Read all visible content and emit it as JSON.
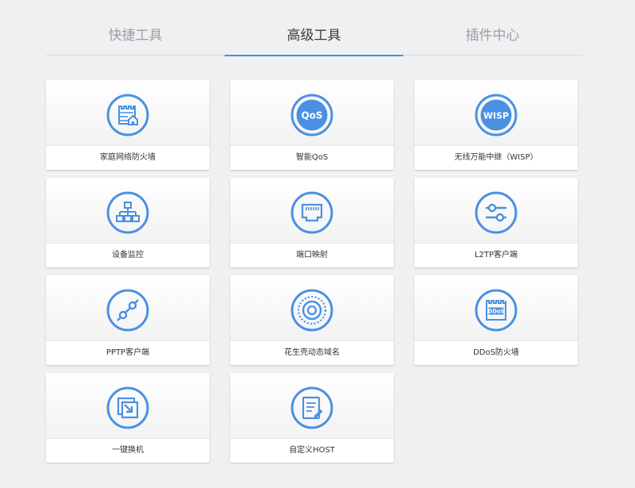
{
  "tabs": [
    {
      "label": "快捷工具"
    },
    {
      "label": "高级工具"
    },
    {
      "label": "插件中心"
    }
  ],
  "active_tab": "高级工具",
  "accent_color": "#4a90e2",
  "tools": [
    {
      "label": "家庭网络防火墙",
      "icon": "firewall-house-icon"
    },
    {
      "label": "智能QoS",
      "icon": "qos-icon",
      "icon_text": "QoS"
    },
    {
      "label": "无线万能中继（WISP）",
      "icon": "wisp-icon",
      "icon_text": "WISP"
    },
    {
      "label": "设备监控",
      "icon": "network-topology-icon"
    },
    {
      "label": "端口映射",
      "icon": "ethernet-port-icon"
    },
    {
      "label": "L2TP客户端",
      "icon": "sliders-icon"
    },
    {
      "label": "PPTP客户端",
      "icon": "tunnel-link-icon"
    },
    {
      "label": "花生壳动态域名",
      "icon": "peanut-shell-ddns-icon"
    },
    {
      "label": "DDoS防火墙",
      "icon": "ddos-firewall-icon",
      "icon_text": "DDoS"
    },
    {
      "label": "一键换机",
      "icon": "device-switch-icon"
    },
    {
      "label": "自定义HOST",
      "icon": "edit-host-icon"
    }
  ]
}
